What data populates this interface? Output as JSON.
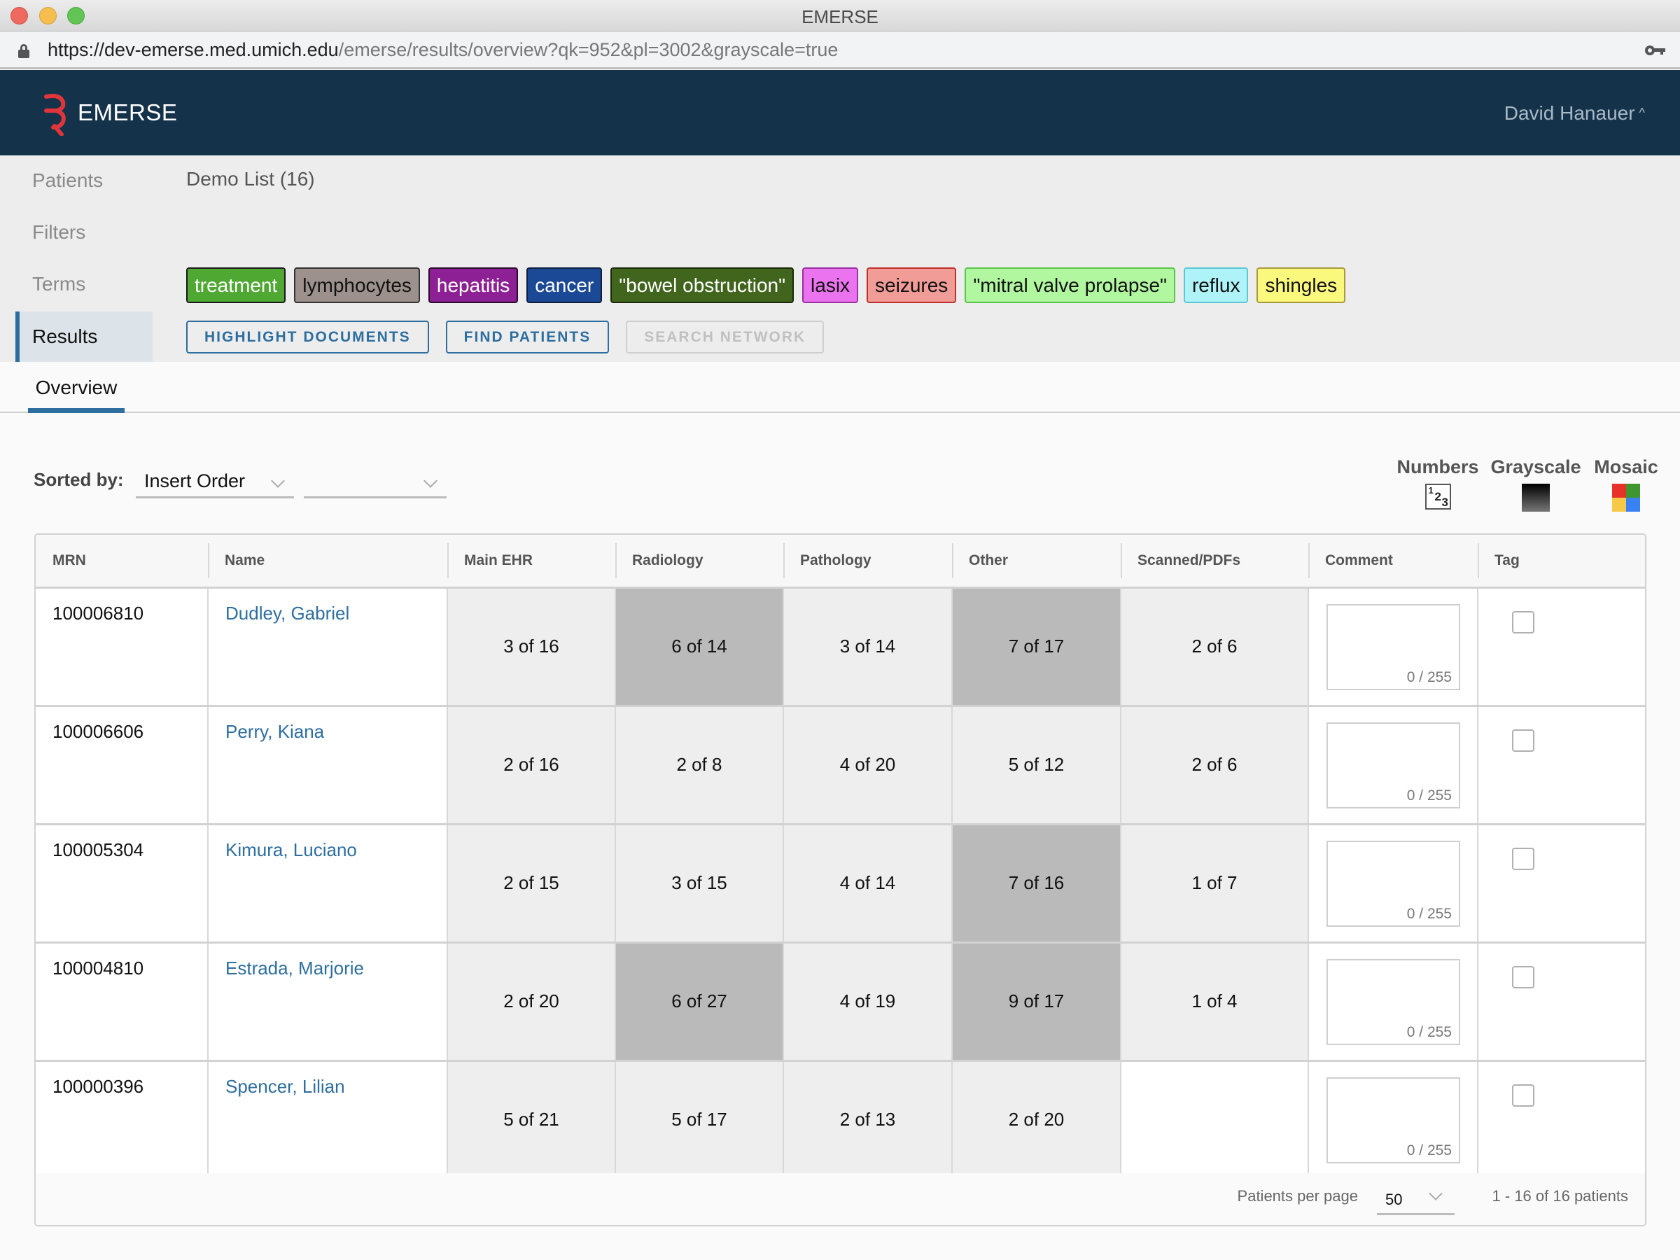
{
  "window": {
    "title": "EMERSE"
  },
  "browser": {
    "url_host": "https://dev-emerse.med.umich.edu",
    "url_path": "/emerse/results/overview?qk=952&pl=3002&grayscale=true"
  },
  "header": {
    "app_name": "EMERSE",
    "user_name": "David Hanauer",
    "user_caret": "^"
  },
  "sidebar": {
    "items": [
      {
        "label": "Patients",
        "active": false
      },
      {
        "label": "Filters",
        "active": false
      },
      {
        "label": "Terms",
        "active": false
      },
      {
        "label": "Results",
        "active": true
      }
    ]
  },
  "list_name": "Demo List (16)",
  "terms": [
    {
      "label": "treatment",
      "bg": "#4ea832",
      "fg": "#ffffff",
      "border": "#1a1a1a"
    },
    {
      "label": "lymphocytes",
      "bg": "#9c918c",
      "fg": "#111111",
      "border": "#333333"
    },
    {
      "label": "hepatitis",
      "bg": "#8e2095",
      "fg": "#ffffff",
      "border": "#2a0a2c"
    },
    {
      "label": "cancer",
      "bg": "#1b4995",
      "fg": "#ffffff",
      "border": "#0d1f40"
    },
    {
      "label": "\"bowel obstruction\"",
      "bg": "#41651d",
      "fg": "#ffffff",
      "border": "#1a2a0a"
    },
    {
      "label": "lasix",
      "bg": "#ec73f0",
      "fg": "#111111",
      "border": "#9a30a0"
    },
    {
      "label": "seizures",
      "bg": "#f29c98",
      "fg": "#111111",
      "border": "#c0302a"
    },
    {
      "label": "\"mitral valve prolapse\"",
      "bg": "#b1f7a0",
      "fg": "#111111",
      "border": "#5bc44a"
    },
    {
      "label": "reflux",
      "bg": "#aef3f8",
      "fg": "#111111",
      "border": "#5cc8d4"
    },
    {
      "label": "shingles",
      "bg": "#fbf87e",
      "fg": "#111111",
      "border": "#a89a3a"
    }
  ],
  "actions": {
    "highlight": "HIGHLIGHT DOCUMENTS",
    "find": "FIND PATIENTS",
    "network": "SEARCH NETWORK"
  },
  "tabs": [
    {
      "label": "Overview",
      "active": true
    }
  ],
  "sort": {
    "label": "Sorted by:",
    "primary": "Insert Order",
    "secondary": ""
  },
  "view_modes": {
    "numbers": "Numbers",
    "grayscale": "Grayscale",
    "mosaic": "Mosaic",
    "mosaic_colors": [
      "#e63228",
      "#3f962e",
      "#f7c948",
      "#3a82f4"
    ]
  },
  "table": {
    "columns": [
      "MRN",
      "Name",
      "Main EHR",
      "Radiology",
      "Pathology",
      "Other",
      "Scanned/PDFs",
      "Comment",
      "Tag"
    ],
    "rows": [
      {
        "mrn": "100006810",
        "name": "Dudley, Gabriel",
        "counts": [
          "3 of 16",
          "6 of 14",
          "3 of 14",
          "7 of 17",
          "2 of 6"
        ],
        "highlight": [
          false,
          true,
          false,
          true,
          false
        ],
        "comment_counter": "0 / 255",
        "tagged": false
      },
      {
        "mrn": "100006606",
        "name": "Perry, Kiana",
        "counts": [
          "2 of 16",
          "2 of 8",
          "4 of 20",
          "5 of 12",
          "2 of 6"
        ],
        "highlight": [
          false,
          false,
          false,
          false,
          false
        ],
        "comment_counter": "0 / 255",
        "tagged": false
      },
      {
        "mrn": "100005304",
        "name": "Kimura, Luciano",
        "counts": [
          "2 of 15",
          "3 of 15",
          "4 of 14",
          "7 of 16",
          "1 of 7"
        ],
        "highlight": [
          false,
          false,
          false,
          true,
          false
        ],
        "comment_counter": "0 / 255",
        "tagged": false
      },
      {
        "mrn": "100004810",
        "name": "Estrada, Marjorie",
        "counts": [
          "2 of 20",
          "6 of 27",
          "4 of 19",
          "9 of 17",
          "1 of 4"
        ],
        "highlight": [
          false,
          true,
          false,
          true,
          false
        ],
        "comment_counter": "0 / 255",
        "tagged": false
      },
      {
        "mrn": "100000396",
        "name": "Spencer, Lilian",
        "counts": [
          "5 of 21",
          "5 of 17",
          "2 of 13",
          "2 of 20",
          ""
        ],
        "highlight": [
          false,
          false,
          false,
          false,
          false
        ],
        "comment_counter": "0 / 255",
        "tagged": false
      }
    ]
  },
  "pagination": {
    "per_page_label": "Patients per page",
    "per_page": "50",
    "range": "1 - 16 of 16 patients"
  }
}
